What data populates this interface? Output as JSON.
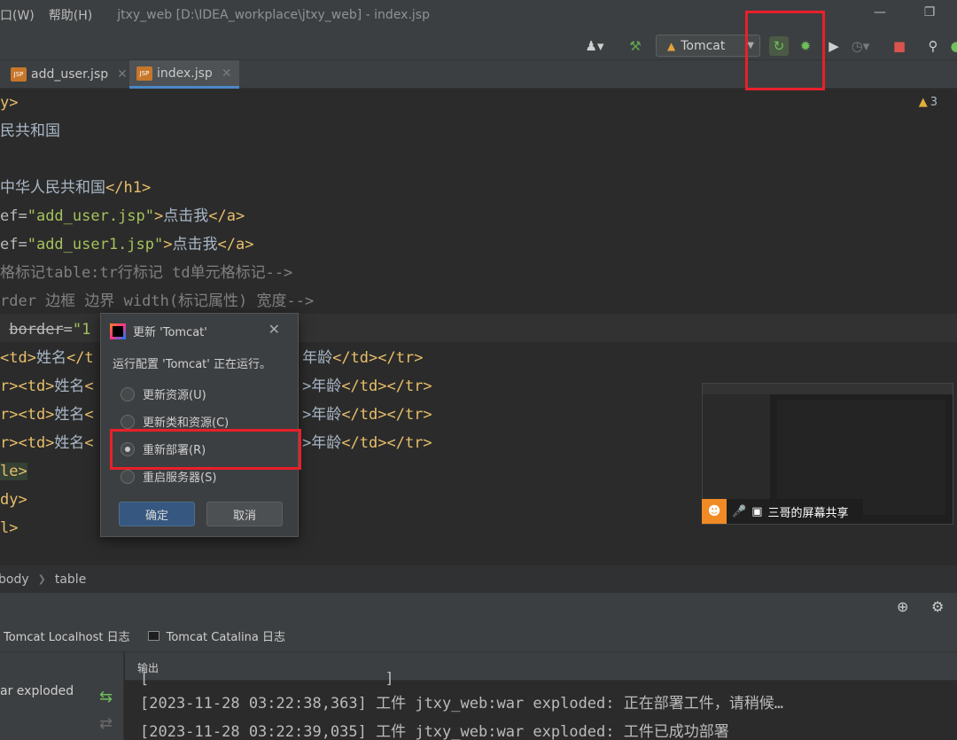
{
  "menu": {
    "window": "口(W)",
    "help": "帮助(H)"
  },
  "window_title": "jtxy_web [D:\\IDEA_workplace\\jtxy_web] - index.jsp",
  "toolbar": {
    "run_config": "Tomcat"
  },
  "tabs": [
    {
      "label": "add_user.jsp",
      "badge": "JSP"
    },
    {
      "label": "index.jsp",
      "badge": "JSP"
    }
  ],
  "editor": {
    "warning_count": "3",
    "lines": [
      {
        "parts": [
          {
            "c": "tag",
            "t": "y>"
          }
        ]
      },
      {
        "parts": [
          {
            "c": "text",
            "t": "民共和国"
          }
        ]
      },
      {
        "parts": []
      },
      {
        "parts": [
          {
            "c": "text",
            "t": "中华人民共和国"
          },
          {
            "c": "tag",
            "t": "</h1>"
          }
        ]
      },
      {
        "parts": [
          {
            "c": "attr",
            "t": "ef="
          },
          {
            "c": "val",
            "t": "\"add_user.jsp\""
          },
          {
            "c": "tag",
            "t": ">"
          },
          {
            "c": "text",
            "t": "点击我"
          },
          {
            "c": "tag",
            "t": "</a>"
          }
        ]
      },
      {
        "parts": [
          {
            "c": "attr",
            "t": "ef="
          },
          {
            "c": "val",
            "t": "\"add_user1.jsp\""
          },
          {
            "c": "tag",
            "t": ">"
          },
          {
            "c": "text",
            "t": "点击我"
          },
          {
            "c": "tag",
            "t": "</a>"
          }
        ]
      },
      {
        "parts": [
          {
            "c": "comment",
            "t": "格标记table:tr行标记 td单元格标记-->"
          }
        ]
      },
      {
        "parts": [
          {
            "c": "comment",
            "t": "rder 边框 边界 width(标记属性) 宽度-->"
          }
        ]
      },
      {
        "parts": [
          {
            "c": "attr",
            "t": " "
          },
          {
            "c": "attr strike",
            "t": "border"
          },
          {
            "c": "attr",
            "t": "="
          },
          {
            "c": "val",
            "t": "\"1"
          }
        ]
      },
      {
        "parts": [
          {
            "c": "tag",
            "t": "<td>"
          },
          {
            "c": "text",
            "t": "姓名"
          },
          {
            "c": "tag",
            "t": "</t"
          },
          {
            "c": "text",
            "t": "                       年龄"
          },
          {
            "c": "tag",
            "t": "</td></tr>"
          }
        ]
      },
      {
        "parts": [
          {
            "c": "tag",
            "t": "r><td>"
          },
          {
            "c": "text",
            "t": "姓名"
          },
          {
            "c": "tag",
            "t": "<"
          },
          {
            "c": "text",
            "t": "                       >年龄"
          },
          {
            "c": "tag",
            "t": "</td></tr>"
          }
        ]
      },
      {
        "parts": [
          {
            "c": "tag",
            "t": "r><td>"
          },
          {
            "c": "text",
            "t": "姓名"
          },
          {
            "c": "tag",
            "t": "<"
          },
          {
            "c": "text",
            "t": "                       >年龄"
          },
          {
            "c": "tag",
            "t": "</td></tr>"
          }
        ]
      },
      {
        "parts": [
          {
            "c": "tag",
            "t": "r><td>"
          },
          {
            "c": "text",
            "t": "姓名"
          },
          {
            "c": "tag",
            "t": "<"
          },
          {
            "c": "text",
            "t": "                       >年龄"
          },
          {
            "c": "tag",
            "t": "</td></tr>"
          }
        ]
      },
      {
        "parts": [
          {
            "c": "tag hl",
            "t": "le>"
          }
        ]
      },
      {
        "parts": [
          {
            "c": "tag",
            "t": "dy>"
          }
        ]
      },
      {
        "parts": [
          {
            "c": "tag",
            "t": "l>"
          }
        ]
      }
    ]
  },
  "dialog": {
    "title": "更新 'Tomcat'",
    "message": "运行配置 'Tomcat' 正在运行。",
    "options": [
      {
        "label": "更新资源(U)",
        "selected": false
      },
      {
        "label": "更新类和资源(C)",
        "selected": false
      },
      {
        "label": "重新部署(R)",
        "selected": true
      },
      {
        "label": "重启服务器(S)",
        "selected": false
      }
    ],
    "ok": "确定",
    "cancel": "取消"
  },
  "share": {
    "label": "三哥的屏幕共享"
  },
  "breadcrumb": [
    "body",
    "table"
  ],
  "services": {
    "log_tabs": [
      "Tomcat Localhost 日志",
      "Tomcat Catalina 日志"
    ],
    "output_label": "输出",
    "tree_item": "ar exploded",
    "console_lines": [
      "[2023-11-28 03:22:38,363] 工件 jtxy_web:war exploded: 正在部署工件，请稍候…",
      "[2023-11-28 03:22:39,035] 工件 jtxy_web:war exploded: 工件已成功部署"
    ]
  },
  "colors": {
    "highlight": "#e8202a",
    "accent": "#4a88c7"
  }
}
